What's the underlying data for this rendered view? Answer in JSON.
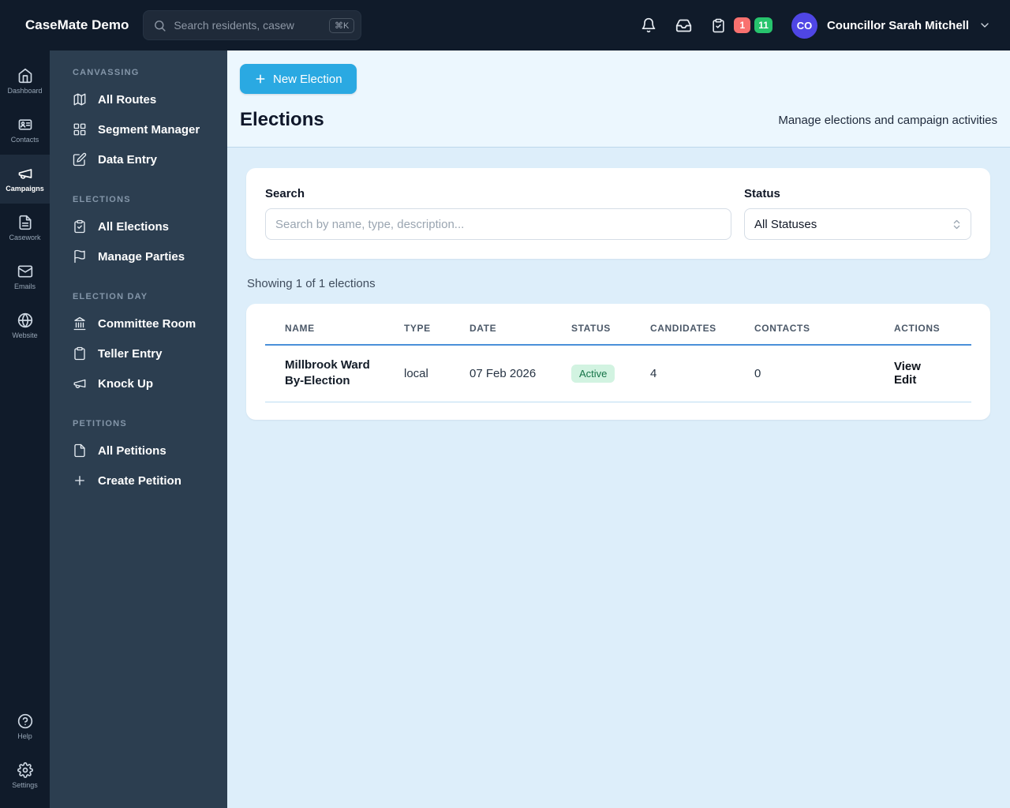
{
  "header": {
    "app_title": "CaseMate Demo",
    "search_placeholder": "Search residents, casew",
    "search_shortcut": "⌘K",
    "badge_red": "1",
    "badge_green": "11",
    "avatar_initials": "CO",
    "user_name": "Councillor Sarah Mitchell"
  },
  "icon_rail": {
    "items": [
      {
        "label": "Dashboard",
        "icon": "home-icon",
        "active": false
      },
      {
        "label": "Contacts",
        "icon": "contacts-icon",
        "active": false
      },
      {
        "label": "Campaigns",
        "icon": "megaphone-icon",
        "active": true
      },
      {
        "label": "Casework",
        "icon": "file-icon",
        "active": false
      },
      {
        "label": "Emails",
        "icon": "envelope-icon",
        "active": false
      },
      {
        "label": "Website",
        "icon": "globe-icon",
        "active": false
      }
    ],
    "bottom_items": [
      {
        "label": "Help",
        "icon": "help-icon"
      },
      {
        "label": "Settings",
        "icon": "gear-icon"
      }
    ]
  },
  "sidebar": {
    "sections": [
      {
        "title": "CANVASSING",
        "items": [
          {
            "label": "All Routes",
            "icon": "map-icon"
          },
          {
            "label": "Segment Manager",
            "icon": "grid-icon"
          },
          {
            "label": "Data Entry",
            "icon": "pencil-icon"
          }
        ]
      },
      {
        "title": "ELECTIONS",
        "items": [
          {
            "label": "All Elections",
            "icon": "clipboard-icon"
          },
          {
            "label": "Manage Parties",
            "icon": "flag-icon"
          }
        ]
      },
      {
        "title": "ELECTION DAY",
        "items": [
          {
            "label": "Committee Room",
            "icon": "building-icon"
          },
          {
            "label": "Teller Entry",
            "icon": "clipboard-icon"
          },
          {
            "label": "Knock Up",
            "icon": "megaphone-icon"
          }
        ]
      },
      {
        "title": "PETITIONS",
        "items": [
          {
            "label": "All Petitions",
            "icon": "file-icon"
          },
          {
            "label": "Create Petition",
            "icon": "plus-icon"
          }
        ]
      }
    ]
  },
  "main": {
    "new_election_button": "New Election",
    "page_title": "Elections",
    "page_subtitle": "Manage elections and campaign activities",
    "filters": {
      "search_label": "Search",
      "search_placeholder": "Search by name, type, description...",
      "status_label": "Status",
      "status_value": "All Statuses"
    },
    "results_summary": "Showing 1 of 1 elections",
    "table": {
      "columns": [
        "Name",
        "Type",
        "Date",
        "Status",
        "Candidates",
        "Contacts",
        "Actions"
      ],
      "rows": [
        {
          "name": "Millbrook Ward By-Election",
          "type": "local",
          "date": "07 Feb 2026",
          "status": "Active",
          "candidates": "4",
          "contacts": "0",
          "view_label": "View",
          "edit_label": "Edit"
        }
      ]
    }
  },
  "colors": {
    "accent_blue": "#2aa9e2",
    "header_bg": "#101b2a",
    "sidebar_bg": "#2c3e50",
    "main_bg": "#ddeefa",
    "active_badge_bg": "#d2f3e1",
    "active_badge_text": "#157347",
    "alert_red": "#f9716f",
    "alert_green": "#27c46d",
    "avatar_bg": "#4f46e5"
  }
}
